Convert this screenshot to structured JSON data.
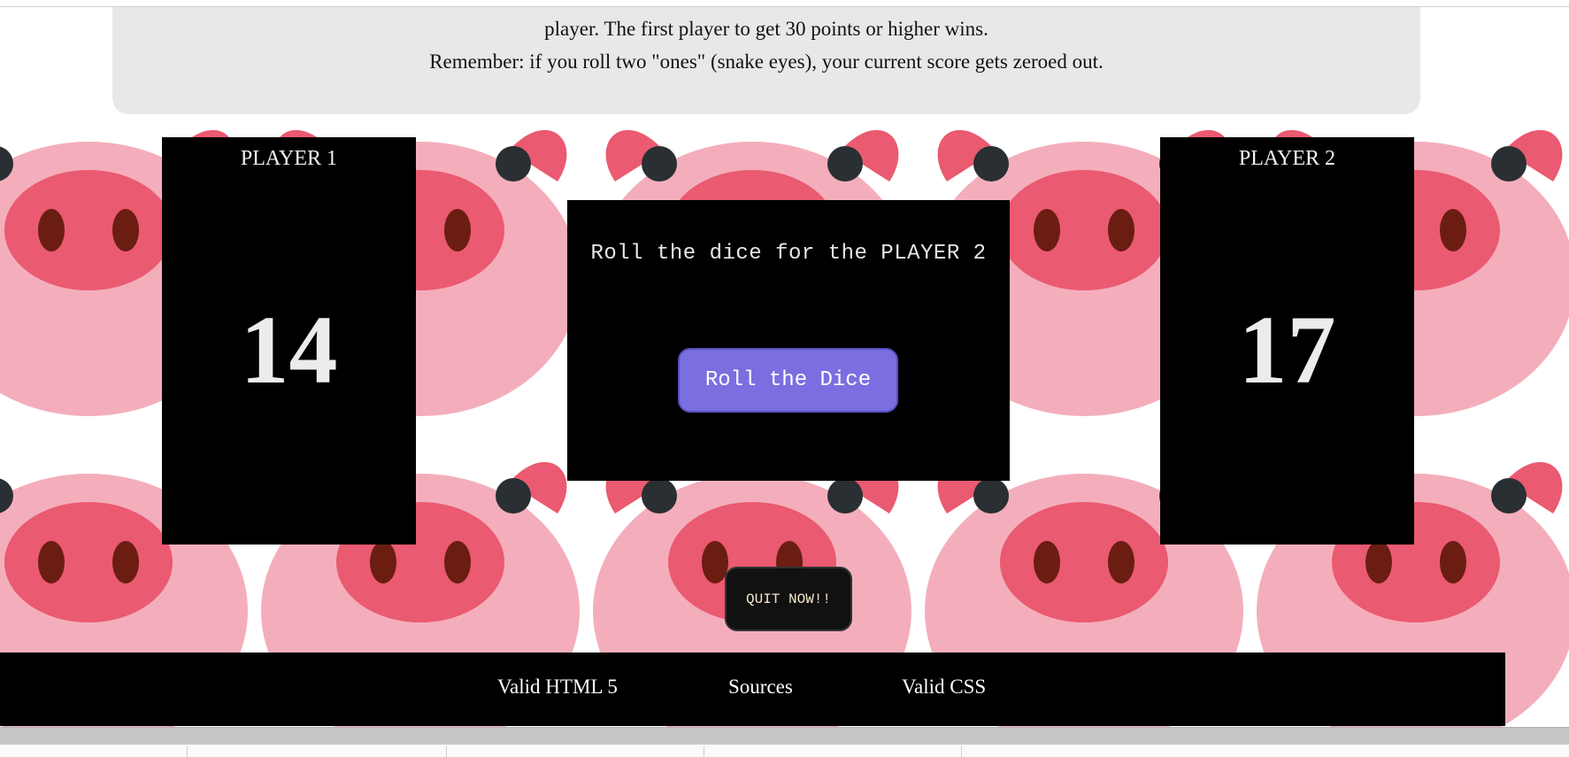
{
  "rules": {
    "line1": "player. The first player to get 30 points or higher wins.",
    "line2": "Remember: if you roll two \"ones\" (snake eyes), your current score gets zeroed out."
  },
  "players": [
    {
      "name": "PLAYER 1",
      "score": "14"
    },
    {
      "name": "PLAYER 2",
      "score": "17"
    }
  ],
  "game": {
    "message": "Roll the dice for the PLAYER 2",
    "roll_label": "Roll the Dice",
    "quit_label": "QUIT NOW!!"
  },
  "footer": {
    "links": [
      "Valid HTML 5",
      "Sources",
      "Valid CSS"
    ]
  },
  "colors": {
    "pig_light": "#f4aebb",
    "pig_snout": "#ea5a70",
    "pig_nostril": "#6b1d12",
    "pig_eye": "#292f33",
    "roll_button": "#7b6ee0"
  }
}
